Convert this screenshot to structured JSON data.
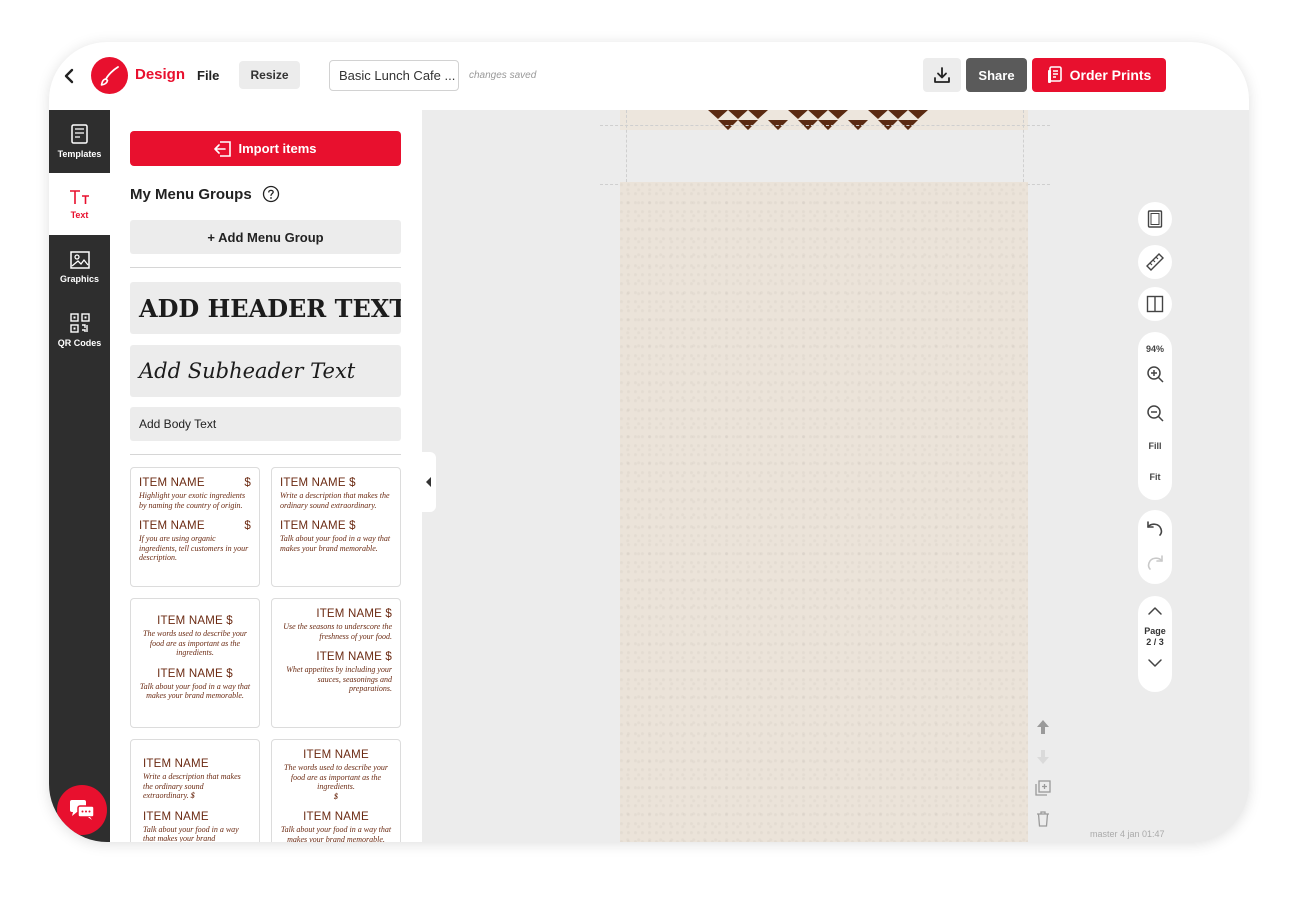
{
  "topbar": {
    "app_label": "Design",
    "file_label": "File",
    "resize_label": "Resize",
    "document_title": "Basic Lunch Cafe ...",
    "save_status": "changes saved",
    "share_label": "Share",
    "order_label": "Order Prints"
  },
  "leftnav": {
    "items": [
      {
        "label": "Templates",
        "icon": "templates-icon"
      },
      {
        "label": "Text",
        "icon": "text-icon"
      },
      {
        "label": "Graphics",
        "icon": "graphics-icon"
      },
      {
        "label": "QR Codes",
        "icon": "qr-code-icon"
      }
    ]
  },
  "panel": {
    "import_label": "Import items",
    "groups_title": "My Menu Groups",
    "add_group_label": "+ Add Menu Group",
    "header_sample": "ADD HEADER TEXT",
    "subheader_sample": "Add Subheader Text",
    "body_sample": "Add Body Text",
    "cards": [
      {
        "rows": [
          {
            "name": "ITEM NAME",
            "price": "$",
            "desc": "Highlight your exotic ingredients by naming the country of origin."
          },
          {
            "name": "ITEM NAME",
            "price": "$",
            "desc": "If you are using organic ingredients, tell customers in your description."
          }
        ]
      },
      {
        "rows": [
          {
            "name": "ITEM NAME $",
            "price": "",
            "desc": "Write a description that makes the ordinary sound extraordinary."
          },
          {
            "name": "ITEM NAME $",
            "price": "",
            "desc": "Talk about your food in a way that makes your brand memorable."
          }
        ]
      },
      {
        "rows": [
          {
            "name": "ITEM NAME $",
            "price": "",
            "desc": "The words used to describe your food are as important as the ingredients."
          },
          {
            "name": "ITEM NAME $",
            "price": "",
            "desc": "Talk about your food in a way that makes your brand memorable."
          }
        ]
      },
      {
        "rows": [
          {
            "name": "ITEM NAME $",
            "price": "",
            "desc": "Use the seasons to underscore the freshness of your food."
          },
          {
            "name": "ITEM NAME $",
            "price": "",
            "desc": "Whet appetites by including your sauces, seasonings and preparations."
          }
        ]
      },
      {
        "rows": [
          {
            "name": "ITEM NAME",
            "price": "",
            "desc": "Write a description that makes the ordinary sound extraordinary.",
            "tail": "$"
          },
          {
            "name": "ITEM NAME",
            "price": "",
            "desc": "Talk about your food in a way that makes your brand memorable."
          }
        ]
      },
      {
        "rows": [
          {
            "name": "ITEM NAME",
            "price": "",
            "desc": "The words used to describe your food are as important as the ingredients.",
            "tail": "$"
          },
          {
            "name": "ITEM NAME",
            "price": "",
            "desc": "Talk about your food in a way that makes your brand memorable."
          }
        ]
      }
    ]
  },
  "canvas_tools": {
    "zoom_level": "94%",
    "fill_label": "Fill",
    "fit_label": "Fit",
    "page_word": "Page",
    "page_indicator": "2 / 3",
    "version_text": "master 4 jan 01:47"
  },
  "colors": {
    "brand_red": "#e8102e",
    "nav_dark": "#2e2e2e",
    "menu_brown": "#6b2a12",
    "paper": "#ebe3d9"
  }
}
